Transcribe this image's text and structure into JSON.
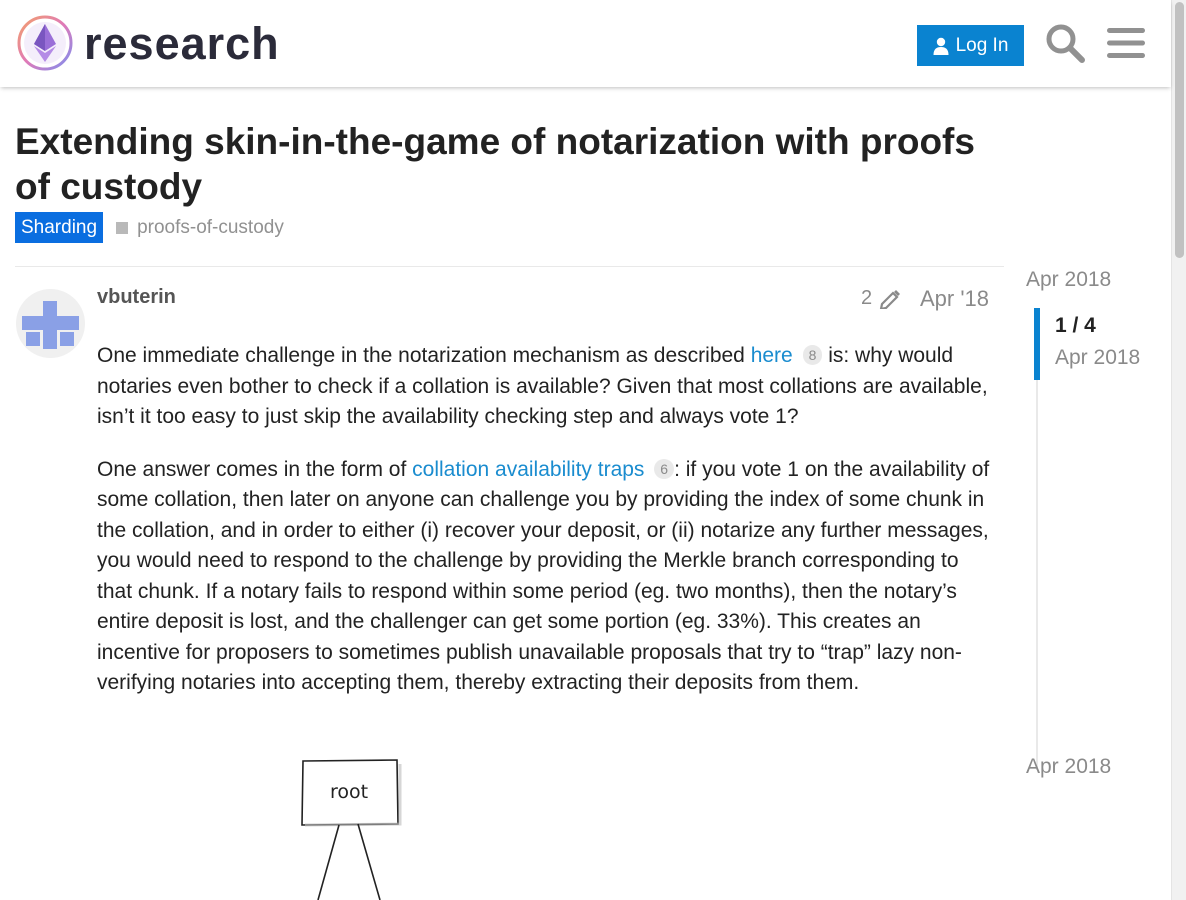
{
  "header": {
    "logo_text": "research",
    "login_label": "Log In",
    "icons": [
      "search-icon",
      "hamburger-menu-icon",
      "user-icon"
    ],
    "accent_color": "#0a83d0"
  },
  "topic": {
    "title": "Extending skin-in-the-game of notarization with proofs of custody",
    "category": "Sharding",
    "category_color": "#0a6ee0",
    "tag": "proofs-of-custody"
  },
  "post": {
    "username": "vbuterin",
    "edit_count": "2",
    "date": "Apr '18",
    "p1_before": "One immediate challenge in the notarization mechanism as described ",
    "p1_link": "here",
    "p1_link_clicks": "8",
    "p1_after": " is: why would notaries even bother to check if a collation is available? Given that most collations are available, isn’t it too easy to just skip the availability checking step and always vote 1?",
    "p2_before": "One answer comes in the form of ",
    "p2_link": "collation availability traps",
    "p2_link_clicks": "6",
    "p2_after": ": if you vote 1 on the availability of some collation, then later on anyone can challenge you by providing the index of some chunk in the collation, and in order to either (i) recover your deposit, or (ii) notarize any further messages, you would need to respond to the challenge by providing the Merkle branch corresponding to that chunk. If a notary fails to respond within some period (eg. two months), then the notary’s entire deposit is lost, and the challenger can get some portion (eg. 33%). This creates an incentive for proposers to sometimes publish unavailable proposals that try to “trap” lazy non-verifying notaries into accepting them, thereby extracting their deposits from them.",
    "diagram_label": "root"
  },
  "timeline": {
    "start_date": "Apr 2018",
    "position": "1 / 4",
    "current_date": "Apr 2018",
    "end_date": "Apr 2018"
  }
}
